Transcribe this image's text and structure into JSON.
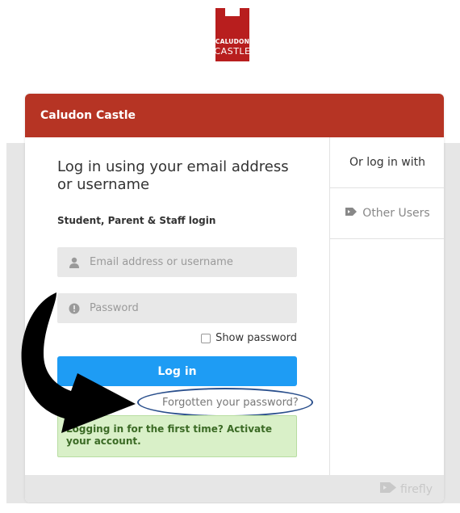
{
  "logo": {
    "line1": "CALUDON",
    "line2": "CASTLE",
    "color": "#b81e1e"
  },
  "header": {
    "title": "Caludon Castle",
    "color": "#b63424"
  },
  "login": {
    "title": "Log in using your email address or username",
    "subtitle": "Student, Parent & Staff login",
    "email_placeholder": "Email address or username",
    "password_placeholder": "Password",
    "show_password": "Show password",
    "button": "Log in",
    "forgot": "Forgotten your password?",
    "activate": "Logging in for the first time? Activate your account.",
    "button_color": "#1e9cf4"
  },
  "sidebar": {
    "heading": "Or log in with",
    "other_users": "Other Users"
  },
  "footer": {
    "brand": "firefly"
  }
}
